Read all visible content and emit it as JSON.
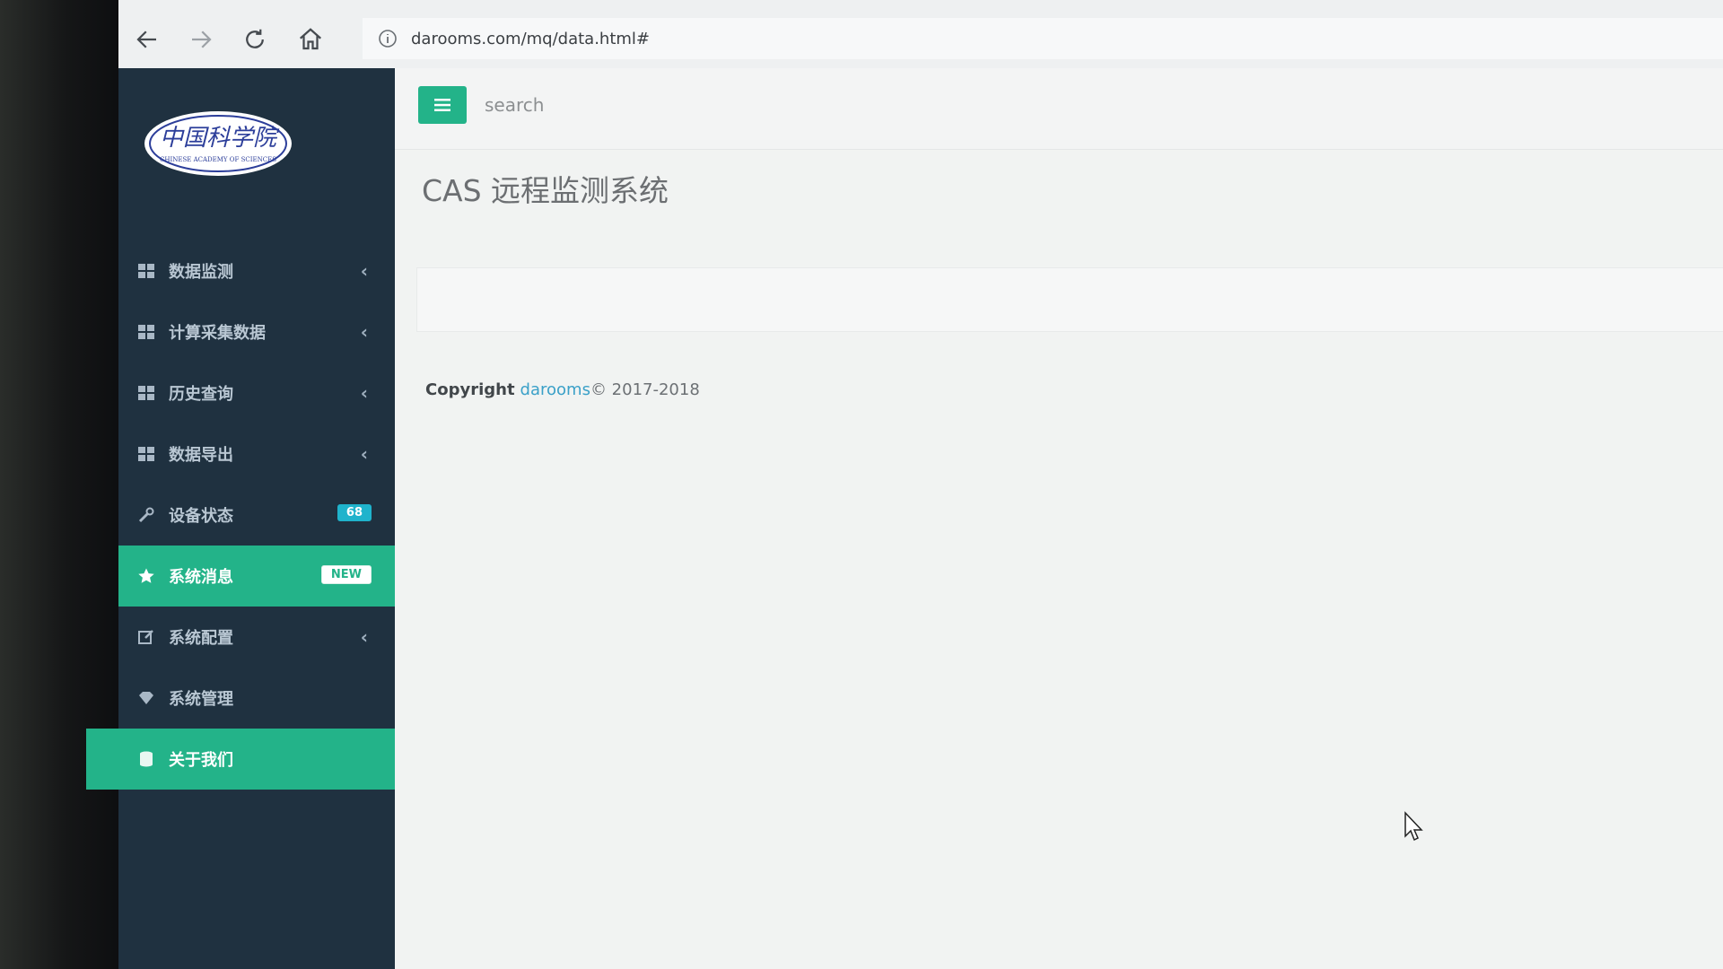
{
  "browser": {
    "url": "darooms.com/mq/data.html#",
    "back_icon": "back-arrow-icon",
    "forward_icon": "forward-arrow-icon",
    "reload_icon": "reload-icon",
    "home_icon": "home-icon",
    "info_icon": "info-icon"
  },
  "sidebar": {
    "logo_alt": "中国科学院 Chinese Academy of Sciences",
    "items": [
      {
        "label": "数据监测",
        "icon": "grid-icon",
        "chevron": "‹"
      },
      {
        "label": "计算采集数据",
        "icon": "grid-icon",
        "chevron": "‹"
      },
      {
        "label": "历史查询",
        "icon": "grid-icon",
        "chevron": "‹"
      },
      {
        "label": "数据导出",
        "icon": "grid-icon",
        "chevron": "‹"
      },
      {
        "label": "设备状态",
        "icon": "wrench-icon",
        "badge": "68"
      },
      {
        "label": "系统消息",
        "icon": "star-icon",
        "badge": "NEW",
        "active": true
      },
      {
        "label": "系统配置",
        "icon": "edit-icon",
        "chevron": "‹"
      },
      {
        "label": "系统管理",
        "icon": "diamond-icon"
      },
      {
        "label": "关于我们",
        "icon": "database-icon",
        "active": true
      }
    ]
  },
  "header": {
    "menu_icon": "hamburger-icon",
    "search_placeholder": "search"
  },
  "main": {
    "title": "CAS 远程监测系统"
  },
  "footer": {
    "copyright_label": "Copyright",
    "brand": "darooms",
    "years": "© 2017-2018"
  },
  "colors": {
    "sidebar_bg": "#1f3140",
    "accent": "#23b389",
    "badge_blue": "#1fb3cc"
  }
}
